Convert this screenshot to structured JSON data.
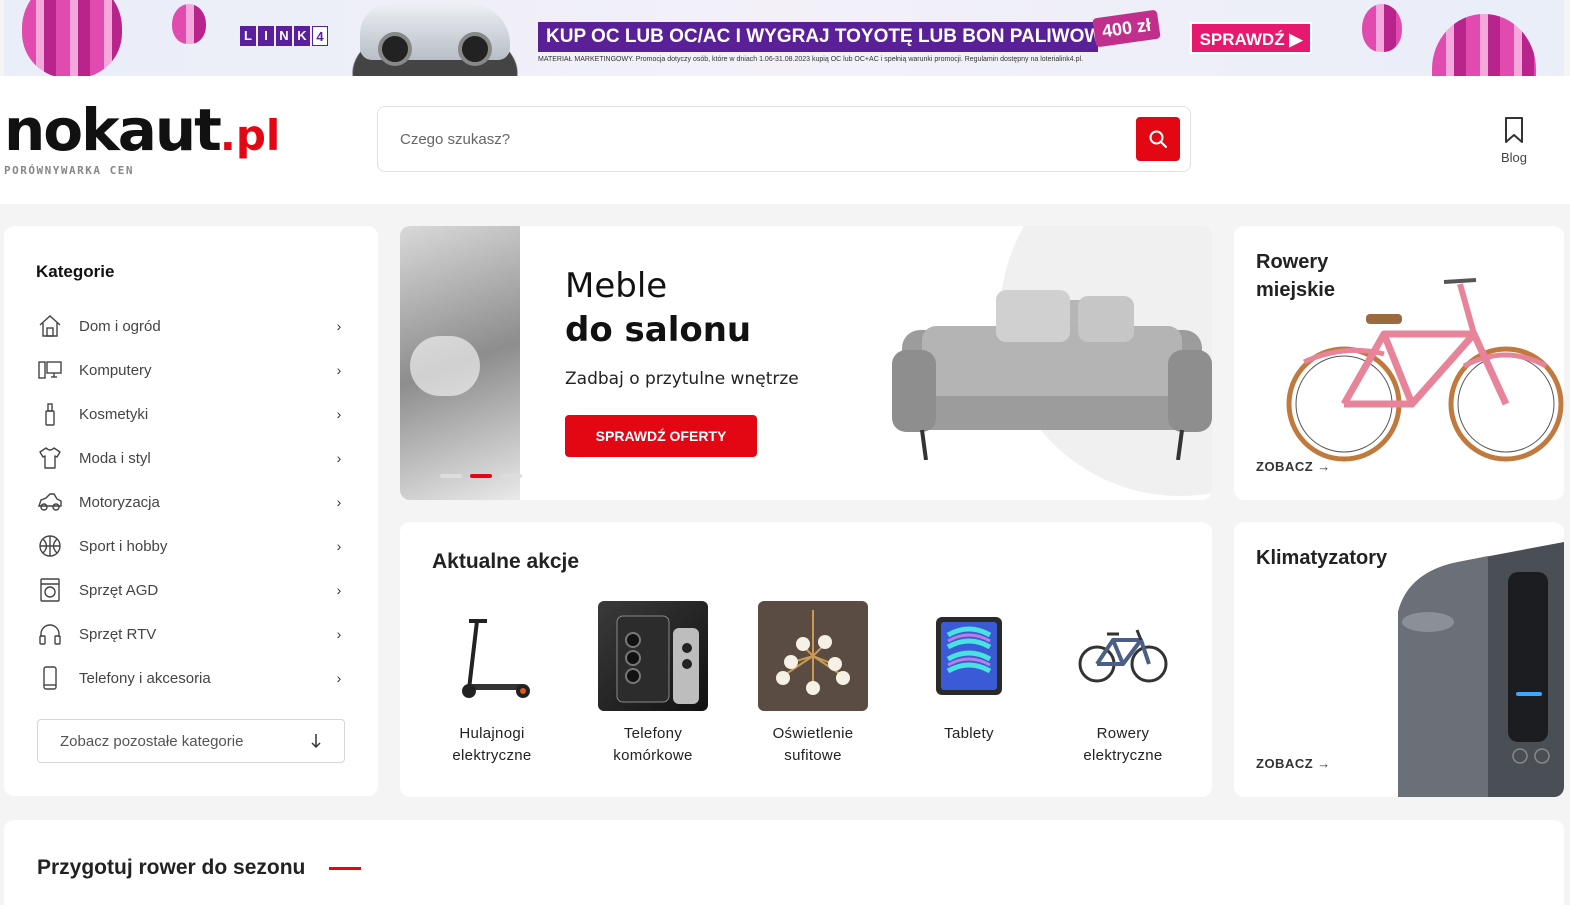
{
  "banner": {
    "brand_letters": [
      "L",
      "I",
      "N",
      "K"
    ],
    "brand_number": "4",
    "headline": "KUP OC LUB OC/AC I WYGRAJ TOYOTĘ LUB BON PALIWOWY",
    "amount": "400 zł",
    "fine_print": "MATERIAŁ MARKETINGOWY. Promocja dotyczy osób, które w dniach 1.06-31.08.2023 kupią OC lub OC+AC i spełnią warunki promocji. Regulamin dostępny na loterialink4.pl.",
    "cta": "SPRAWDŹ ▶"
  },
  "header": {
    "logo_main": "nokaut",
    "logo_suffix": ".pl",
    "logo_tagline": "PORÓWNYWARKA CEN",
    "search_placeholder": "Czego szukasz?",
    "blog_label": "Blog"
  },
  "sidebar": {
    "title": "Kategorie",
    "items": [
      {
        "label": "Dom i ogród",
        "icon": "house-icon"
      },
      {
        "label": "Komputery",
        "icon": "computer-icon"
      },
      {
        "label": "Kosmetyki",
        "icon": "cosmetics-bottle-icon"
      },
      {
        "label": "Moda i styl",
        "icon": "tshirt-icon"
      },
      {
        "label": "Motoryzacja",
        "icon": "car-icon"
      },
      {
        "label": "Sport i hobby",
        "icon": "ball-icon"
      },
      {
        "label": "Sprzęt AGD",
        "icon": "washing-machine-icon"
      },
      {
        "label": "Sprzęt RTV",
        "icon": "headphones-icon"
      },
      {
        "label": "Telefony i akcesoria",
        "icon": "smartphone-icon"
      }
    ],
    "more_label": "Zobacz pozostałe kategorie"
  },
  "hero": {
    "title_line1": "Meble",
    "title_line2": "do salonu",
    "subtitle": "Zadbaj o przytulne wnętrze",
    "button": "SPRAWDŹ OFERTY",
    "slides_count": 3,
    "active_slide": 1
  },
  "cards": {
    "bikes": {
      "title_line1": "Rowery",
      "title_line2": "miejskie",
      "link": "ZOBACZ →"
    },
    "ac": {
      "title": "Klimatyzatory",
      "link": "ZOBACZ →"
    }
  },
  "actions": {
    "title": "Aktualne akcje",
    "items": [
      {
        "label": "Hulajnogi elektryczne"
      },
      {
        "label": "Telefony komórkowe"
      },
      {
        "label": "Oświetlenie sufitowe"
      },
      {
        "label": "Tablety"
      },
      {
        "label": "Rowery elektryczne"
      }
    ]
  },
  "section": {
    "title": "Przygotuj rower do sezonu"
  },
  "colors": {
    "accent": "#e30613",
    "banner_purple": "#5a2098",
    "banner_pink": "#e6196e"
  }
}
